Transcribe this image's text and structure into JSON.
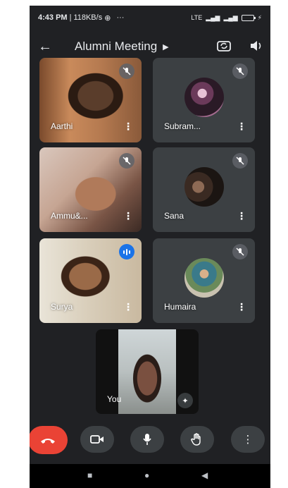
{
  "status_bar": {
    "time": "4:43 PM",
    "speed": "118KB/s",
    "dots": "···",
    "lte": "LTE"
  },
  "header": {
    "title": "Alumni Meeting",
    "title_arrow": "▶"
  },
  "participants": [
    {
      "name": "Aarthi",
      "muted": true,
      "kind": "video"
    },
    {
      "name": "Subram...",
      "muted": true,
      "kind": "avatar"
    },
    {
      "name": "Ammu&...",
      "muted": true,
      "kind": "video"
    },
    {
      "name": "Sana",
      "muted": true,
      "kind": "avatar"
    },
    {
      "name": "Surya",
      "muted": false,
      "speaking": true,
      "kind": "video"
    },
    {
      "name": "Humaira",
      "muted": true,
      "kind": "avatar"
    }
  ],
  "self_tile": {
    "name": "You"
  },
  "icons": {
    "back": "←",
    "more": "⋮",
    "mute": "mic-off-icon",
    "effects": "✦"
  },
  "colors": {
    "background": "#202124",
    "tile": "#3c4043",
    "end_call": "#ea4335",
    "speaking": "#1a73e8"
  }
}
